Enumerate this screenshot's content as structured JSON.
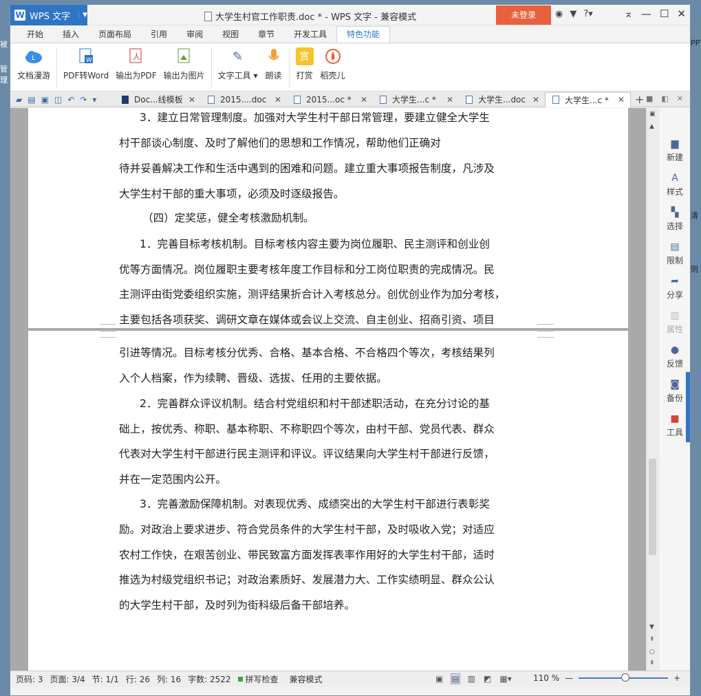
{
  "app": {
    "name": "WPS 文字",
    "logo": "W"
  },
  "title": "大学生村官工作职责.doc * - WPS 文字 - 兼容模式",
  "login_label": "未登录",
  "tabs": [
    "开始",
    "插入",
    "页面布局",
    "引用",
    "审阅",
    "视图",
    "章节",
    "开发工具",
    "特色功能"
  ],
  "active_tab": "特色功能",
  "ribbon": [
    {
      "label": "文档漫游",
      "icon": "cloud-icon"
    },
    {
      "label": "PDF转Word",
      "icon": "pdf-to-word-icon"
    },
    {
      "label": "输出为PDF",
      "icon": "export-pdf-icon"
    },
    {
      "label": "输出为图片",
      "icon": "export-image-icon"
    },
    {
      "label": "文字工具",
      "icon": "text-tools-icon"
    },
    {
      "label": "朗读",
      "icon": "microphone-icon"
    },
    {
      "label": "打赏",
      "icon": "reward-icon",
      "glyph": "赏"
    },
    {
      "label": "稻壳儿",
      "icon": "docer-icon"
    }
  ],
  "doc_tabs": [
    {
      "label": "Doc...线模板"
    },
    {
      "label": "2015....doc"
    },
    {
      "label": "2015...oc *"
    },
    {
      "label": "大学生...c *"
    },
    {
      "label": "大学生...doc"
    },
    {
      "label": "大学生...c *"
    }
  ],
  "paragraphs": [
    "3．建立日常管理制度。加强对大学生村干部日常管理，要建立健全大学生",
    "村干部谈心制度、及时了解他们的思想和工作情况，帮助他们正确对",
    "待并妥善解决工作和生活中遇到的困难和问题。建立重大事项报告制度，凡涉及",
    "大学生村干部的重大事项，必须及时逐级报告。",
    "（四）定奖惩，健全考核激励机制。",
    "1．完善目标考核机制。目标考核内容主要为岗位履职、民主测评和创业创",
    "优等方面情况。岗位履职主要考核年度工作目标和分工岗位职责的完成情况。民",
    "主测评由街党委组织实施，测评结果折合计入考核总分。创优创业作为加分考核，",
    "主要包括各项获奖、调研文章在媒体或会议上交流、自主创业、招商引资、项目",
    "引进等情况。目标考核分优秀、合格、基本合格、不合格四个等次，考核结果列",
    "入个人档案，作为续聘、晋级、选拔、任用的主要依据。",
    "2．完善群众评议机制。结合村党组织和村干部述职活动，在充分讨论的基",
    "础上，按优秀、称职、基本称职、不称职四个等次，由村干部、党员代表、群众",
    "代表对大学生村干部进行民主测评和评议。评议结果向大学生村干部进行反馈，",
    "并在一定范围内公开。",
    "3．完善激励保障机制。对表现优秀、成绩突出的大学生村干部进行表彰奖",
    "励。对政治上要求进步、符合党员条件的大学生村干部，及时吸收入党；对适应",
    "农村工作快，在艰苦创业、带民致富方面发挥表率作用好的大学生村干部，适时",
    "推选为村级党组织书记；对政治素质好、发展潜力大、工作实绩明显、群众公认",
    "的大学生村干部，及时列为街科级后备干部培养。"
  ],
  "side_panel": [
    {
      "label": "新建",
      "icon": "new-doc-icon"
    },
    {
      "label": "样式",
      "icon": "style-icon"
    },
    {
      "label": "选择",
      "icon": "select-icon"
    },
    {
      "label": "限制",
      "icon": "lock-icon"
    },
    {
      "label": "分享",
      "icon": "share-icon"
    },
    {
      "label": "属性",
      "icon": "properties-icon"
    },
    {
      "label": "反馈",
      "icon": "feedback-icon"
    },
    {
      "label": "备份",
      "icon": "backup-icon"
    },
    {
      "label": "工具",
      "icon": "toolbox-icon"
    }
  ],
  "status": {
    "page_num": "页码: 3",
    "pages": "页面: 3/4",
    "section": "节: 1/1",
    "row": "行: 26",
    "col": "列: 16",
    "words": "字数: 2522",
    "spell": "拼写检查",
    "mode": "兼容模式",
    "zoom": "110 %"
  },
  "desktop_fragments": {
    "left": [
      "被",
      "管理"
    ],
    "right": [
      "PPT",
      "清",
      "则"
    ]
  },
  "colors": {
    "accent": "#2e75c6",
    "login": "#e8603e",
    "spell_ok": "#3aa34a"
  }
}
